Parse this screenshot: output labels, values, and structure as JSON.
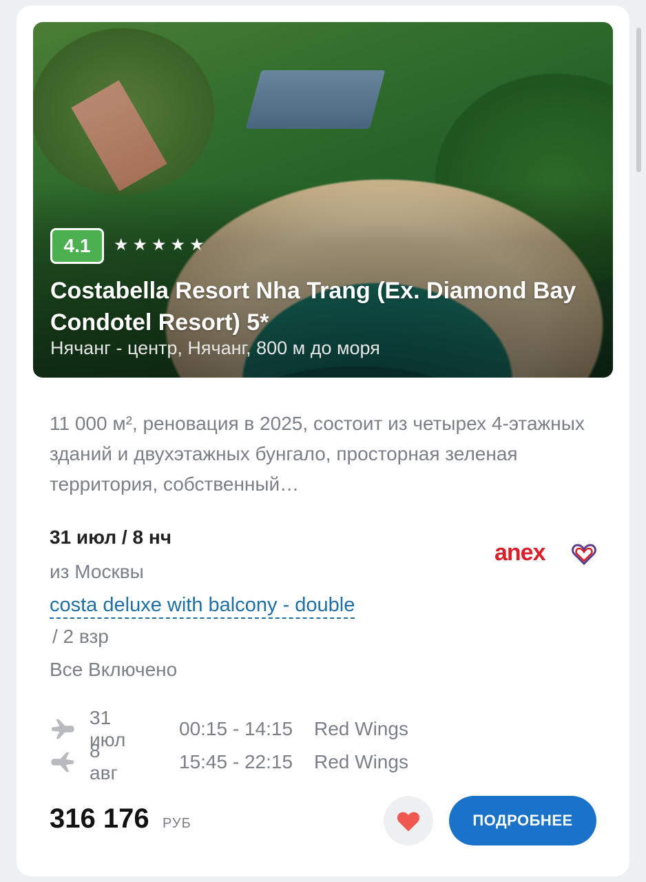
{
  "hotel": {
    "rating": "4.1",
    "stars": 5,
    "name": "Costabella Resort Nha Trang (Ex. Diamond Bay Condotel Resort) 5*",
    "location": "Нячанг - центр, Нячанг, 800 м до моря",
    "description": "11 000 м², реновация в 2025, состоит из четырех 4-этажных зданий и двухэтажных бунгало, просторная зеленая территория, собственный…"
  },
  "tour": {
    "date": "31 июл / 8 нч",
    "from": "из Москвы",
    "room": "costa deluxe with balcony - double",
    "guests": "/ 2 взр",
    "meal": "Все Включено",
    "operator_logo_text": "anex"
  },
  "flights": [
    {
      "direction": "departure",
      "date": "31 июл",
      "time": "00:15 - 14:15",
      "airline": "Red Wings"
    },
    {
      "direction": "return",
      "date": "8 авг",
      "time": "15:45 - 22:15",
      "airline": "Red Wings"
    }
  ],
  "price": {
    "amount": "316 176",
    "currency": "РУБ"
  },
  "actions": {
    "details_label": "ПОДРОБНЕЕ"
  },
  "colors": {
    "accent": "#1a73c8",
    "rating": "#4caf50",
    "favorite": "#f0574f",
    "brand": "#d81f2a"
  },
  "icons": {
    "favorite": "heart-icon",
    "departure": "plane-departure-icon",
    "return": "plane-return-icon"
  }
}
